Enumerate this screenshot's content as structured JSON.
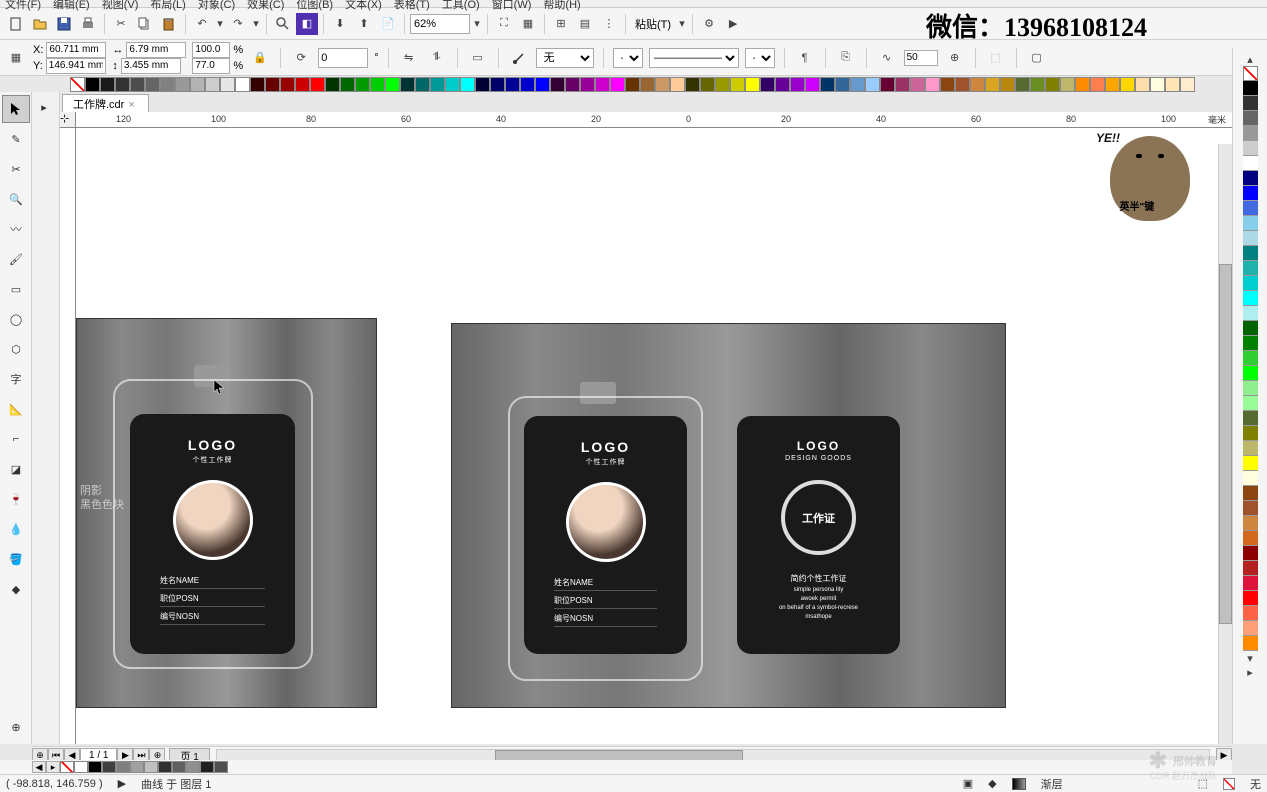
{
  "menu": {
    "file": "文件(F)",
    "edit": "编辑(E)",
    "view": "视图(V)",
    "layout": "布局(L)",
    "object": "对象(C)",
    "effects": "效果(C)",
    "bitmap": "位图(B)",
    "text": "文本(X)",
    "table": "表格(T)",
    "tools": "工具(O)",
    "window": "窗口(W)",
    "help": "帮助(H)"
  },
  "toolbar": {
    "zoom": "62%",
    "paste_label": "粘贴(T)"
  },
  "props": {
    "x_label": "X:",
    "x": "60.711 mm",
    "y_label": "Y:",
    "y": "146.941 mm",
    "w": "6.79 mm",
    "h": "3.455 mm",
    "sx": "100.0",
    "sy": "77.0",
    "pct": "%",
    "rot": "0",
    "deg": "°",
    "outline": "无",
    "nudge": "50"
  },
  "tab": {
    "filename": "工作牌.cdr"
  },
  "ruler": {
    "unit": "毫米",
    "ticks_h": [
      "120",
      "100",
      "80",
      "60",
      "40",
      "20",
      "0",
      "20",
      "40",
      "60",
      "80",
      "100"
    ]
  },
  "artwork": {
    "labels": {
      "shadow": "阴影",
      "blackblock": "黑色色块"
    },
    "logo": "LOGO",
    "logo_sub": "DESIGN GOODS",
    "logo_sub2": "个性工作牌",
    "fields": {
      "name": "姓名NAME",
      "pos": "职位POSN",
      "id": "编号NOSN"
    },
    "back": {
      "title": "工作证",
      "sub1": "简约个性工作证",
      "sub2": "simple persona lity",
      "sub3": "awoek permit",
      "sub4": "on behalf of a symbol-recrese",
      "sub5": "msathope"
    }
  },
  "pagebar": {
    "page": "1 / 1",
    "tab": "页 1"
  },
  "status": {
    "coords": "( -98.818, 146.759 )",
    "object": "曲线 于 图层 1",
    "fill": "渐层",
    "none": "无"
  },
  "overlay": {
    "wechat": "微信：13968108124",
    "ye": "YE!!",
    "sticker_txt": "英半\"键"
  },
  "watermark": {
    "brand": "邢帅教育",
    "sub": "CDR 赵万杰战队"
  },
  "palette_top": [
    "#000000",
    "#1a1a1a",
    "#333333",
    "#4d4d4d",
    "#666666",
    "#808080",
    "#999999",
    "#b3b3b3",
    "#cccccc",
    "#e6e6e6",
    "#ffffff",
    "#330000",
    "#660000",
    "#990000",
    "#cc0000",
    "#ff0000",
    "#003300",
    "#006600",
    "#009900",
    "#00cc00",
    "#00ff00",
    "#003333",
    "#006666",
    "#009999",
    "#00cccc",
    "#00ffff",
    "#000033",
    "#000066",
    "#000099",
    "#0000cc",
    "#0000ff",
    "#330033",
    "#660066",
    "#990099",
    "#cc00cc",
    "#ff00ff",
    "#663300",
    "#996633",
    "#cc9966",
    "#ffcc99",
    "#333300",
    "#666600",
    "#999900",
    "#cccc00",
    "#ffff00",
    "#330066",
    "#660099",
    "#9900cc",
    "#cc00ff",
    "#003366",
    "#336699",
    "#6699cc",
    "#99ccff",
    "#660033",
    "#993366",
    "#cc6699",
    "#ff99cc",
    "#8b4513",
    "#a0522d",
    "#cd853f",
    "#daa520",
    "#b8860b",
    "#556b2f",
    "#6b8e23",
    "#808000",
    "#bdb76b",
    "#ff8c00",
    "#ff7f50",
    "#ffa500",
    "#ffd700",
    "#ffdead",
    "#ffffe0",
    "#ffe4b5",
    "#ffebcd"
  ],
  "palette_right": [
    "#000000",
    "#333333",
    "#666666",
    "#999999",
    "#cccccc",
    "#ffffff",
    "#000080",
    "#0000ff",
    "#4169e1",
    "#87ceeb",
    "#add8e6",
    "#008080",
    "#20b2aa",
    "#00ced1",
    "#00ffff",
    "#afeeee",
    "#006400",
    "#008000",
    "#32cd32",
    "#00ff00",
    "#90ee90",
    "#98fb98",
    "#556b2f",
    "#808000",
    "#bdb76b",
    "#ffff00",
    "#ffffe0",
    "#8b4513",
    "#a0522d",
    "#cd853f",
    "#d2691e",
    "#8b0000",
    "#b22222",
    "#dc143c",
    "#ff0000",
    "#ff6347",
    "#ffa07a",
    "#ff8c00",
    "#ffa500",
    "#ffd700",
    "#4b0082",
    "#800080",
    "#9932cc",
    "#ba55d3",
    "#dda0dd",
    "#ff00ff",
    "#ff69b4",
    "#ffc0cb"
  ],
  "bottom_swatches": [
    "#ffffff",
    "#000000",
    "#404040",
    "#808080",
    "#a0a0a0",
    "#c0c0c0",
    "#303030",
    "#606060",
    "#909090",
    "#202020",
    "#505050"
  ]
}
